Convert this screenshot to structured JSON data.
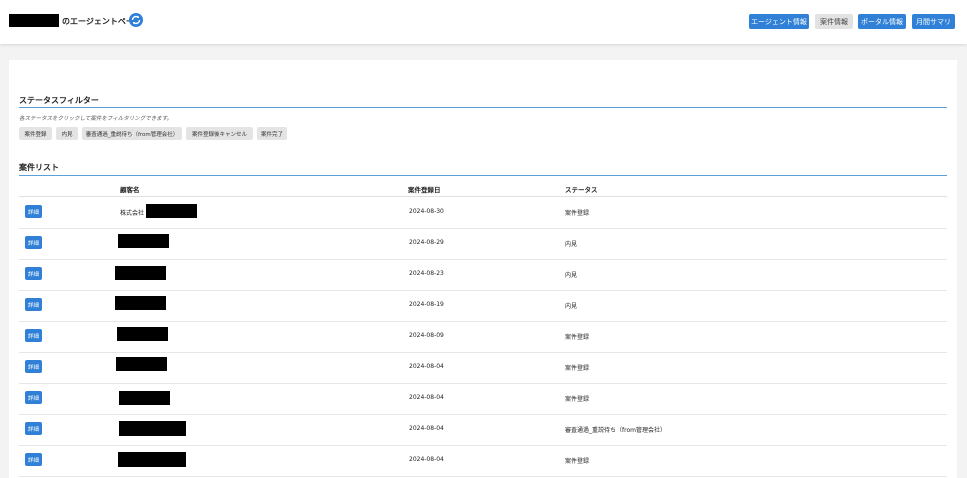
{
  "header": {
    "title_suffix": "のエージェントページ",
    "nav": [
      {
        "label": "エージェント情報",
        "style": "primary"
      },
      {
        "label": "案件情報",
        "style": "gray"
      },
      {
        "label": "ポータル情報",
        "style": "primary"
      },
      {
        "label": "月間サマリ",
        "style": "primary"
      }
    ]
  },
  "status_filter": {
    "title": "ステータスフィルター",
    "hint": "各ステータスをクリックして案件をフィルタリングできます。",
    "buttons": [
      "案件登録",
      "内見",
      "審査通過_重説待ち（from管理会社）",
      "案件登録後キャンセル",
      "案件完了"
    ]
  },
  "case_list": {
    "title": "案件リスト",
    "columns": [
      "顧客名",
      "案件登録日",
      "ステータス"
    ],
    "detail_label": "詳細",
    "rows": [
      {
        "client_prefix": "株式会社",
        "date": "2024-08-30",
        "status": "案件登録"
      },
      {
        "client_prefix": "",
        "date": "2024-08-29",
        "status": "内見"
      },
      {
        "client_prefix": "",
        "date": "2024-08-23",
        "status": "内見"
      },
      {
        "client_prefix": "",
        "date": "2024-08-19",
        "status": "内見"
      },
      {
        "client_prefix": "",
        "date": "2024-08-09",
        "status": "案件登録"
      },
      {
        "client_prefix": "",
        "date": "2024-08-04",
        "status": "案件登録"
      },
      {
        "client_prefix": "",
        "date": "2024-08-04",
        "status": "案件登録"
      },
      {
        "client_prefix": "",
        "date": "2024-08-04",
        "status": "審査通過_重説待ち（from管理会社）"
      },
      {
        "client_prefix": "",
        "date": "2024-08-04",
        "status": "案件登録"
      }
    ]
  },
  "colors": {
    "primary": "#2f80d6",
    "accent_line": "#5ba0dc"
  },
  "icons": {
    "refresh": "refresh-icon"
  }
}
